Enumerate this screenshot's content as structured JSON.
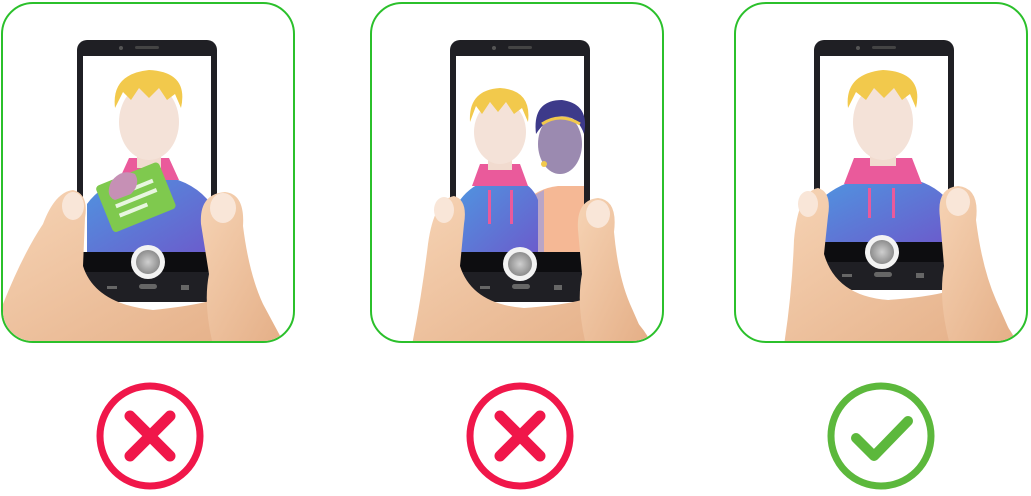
{
  "colors": {
    "frame_border": "#2bc02b",
    "wrong": "#f0174a",
    "correct": "#5cb83c",
    "shirt_top": "#4f8fdc",
    "shirt_bottom": "#6a5fc9",
    "hoodie": "#ea5a9b",
    "hair": "#f2c94c",
    "skin_face": "#f4e2d8",
    "skin_hand": "#f0c9a6",
    "phone_body": "#1f1f24",
    "card_green": "#7fc94e"
  },
  "examples": [
    {
      "scene": "id-card-held-in-front-of-face",
      "verdict": "wrong",
      "verdict_icon": "cross-mark-icon"
    },
    {
      "scene": "two-people-in-frame",
      "verdict": "wrong",
      "verdict_icon": "cross-mark-icon"
    },
    {
      "scene": "single-person-clear-face",
      "verdict": "correct",
      "verdict_icon": "check-mark-icon"
    }
  ]
}
